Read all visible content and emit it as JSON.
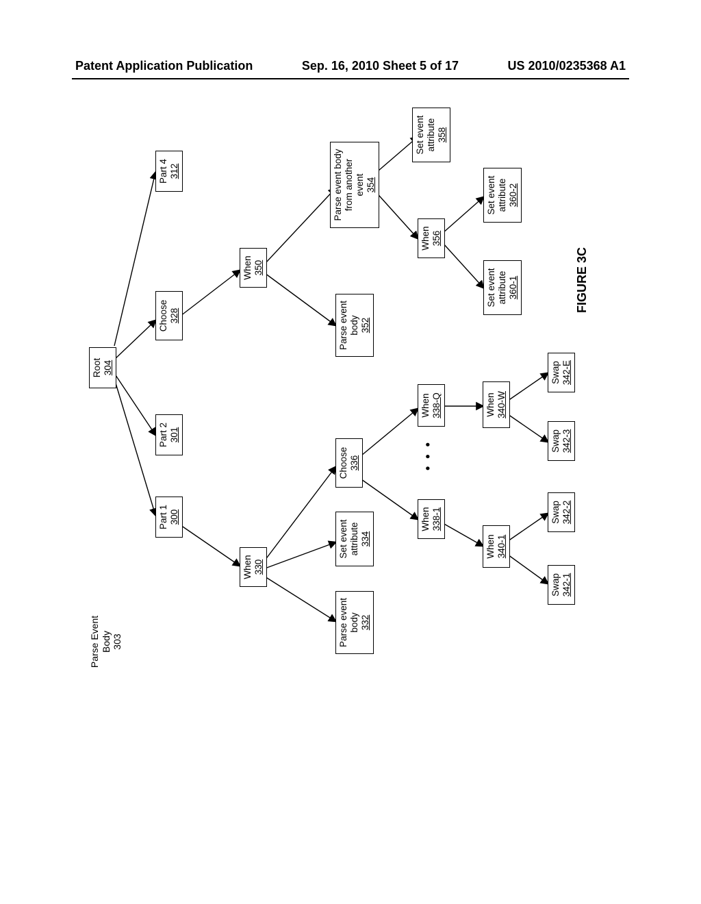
{
  "header": {
    "left": "Patent Application Publication",
    "center": "Sep. 16, 2010  Sheet 5 of 17",
    "right": "US 2010/0235368 A1"
  },
  "figure_label": "FIGURE 3C",
  "title": {
    "l1": "Parse Event",
    "l2": "Body",
    "l3": "303"
  },
  "root": {
    "label": "Root",
    "num": "304"
  },
  "part1": {
    "label": "Part 1",
    "num": "300"
  },
  "part2": {
    "label": "Part 2",
    "num": "301"
  },
  "choose328": {
    "label": "Choose",
    "num": "328"
  },
  "part4": {
    "label": "Part 4",
    "num": "312"
  },
  "when330": {
    "label": "When",
    "num": "330"
  },
  "when350": {
    "label": "When",
    "num": "350"
  },
  "peb332": {
    "l1": "Parse event",
    "l2": "body",
    "num": "332"
  },
  "sea334": {
    "l1": "Set event",
    "l2": "attribute",
    "num": "334"
  },
  "choose336": {
    "label": "Choose",
    "num": "336"
  },
  "peb352": {
    "l1": "Parse event",
    "l2": "body",
    "num": "352"
  },
  "pebfa354": {
    "l1": "Parse event body",
    "l2": "from another",
    "l3": "event",
    "num": "354"
  },
  "when3381": {
    "label": "When",
    "num": "338-1"
  },
  "when338Q": {
    "label": "When",
    "num": "338-Q"
  },
  "when356": {
    "label": "When",
    "num": "356"
  },
  "sea358": {
    "l1": "Set event",
    "l2": "attribute",
    "num": "358"
  },
  "when3401": {
    "label": "When",
    "num": "340-1"
  },
  "when340W": {
    "label": "When",
    "num": "340-W"
  },
  "sea3601": {
    "l1": "Set event",
    "l2": "attribute",
    "num": "360-1"
  },
  "sea3602": {
    "l1": "Set event",
    "l2": "attribute",
    "num": "360-2"
  },
  "swap3421": {
    "label": "Swap",
    "num": "342-1"
  },
  "swap3422": {
    "label": "Swap",
    "num": "342-2"
  },
  "swap3423": {
    "label": "Swap",
    "num": "342-3"
  },
  "swap342E": {
    "label": "Swap",
    "num": "342-E"
  },
  "dots": "• • •"
}
